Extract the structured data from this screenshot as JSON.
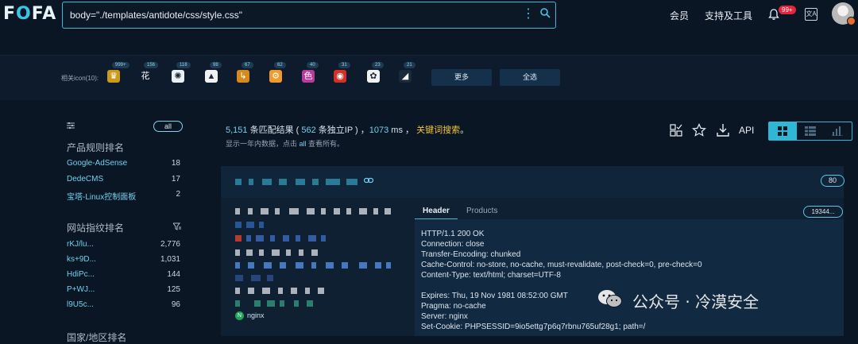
{
  "app": {
    "logo": "FOFA"
  },
  "search": {
    "value": "body=\"./templates/antidote/css/style.css\""
  },
  "nav": {
    "member": "会员",
    "support": "支持及工具",
    "badge": "99+",
    "translate": "文A"
  },
  "icons": {
    "label": "相关icon(10):",
    "items": [
      {
        "count": "999+",
        "color": "#c99a1b",
        "glyph": "♛"
      },
      {
        "count": "156",
        "color": "#0d1b2c",
        "glyph": "花"
      },
      {
        "count": "118",
        "color": "#e9f1f7",
        "glyph": "✺"
      },
      {
        "count": "98",
        "color": "#f2f2f2",
        "glyph": "▲"
      },
      {
        "count": "67",
        "color": "#d48a1c",
        "glyph": "↳"
      },
      {
        "count": "62",
        "color": "#f19a2c",
        "glyph": "⚙"
      },
      {
        "count": "40",
        "color": "#b93c9b",
        "glyph": "色"
      },
      {
        "count": "31",
        "color": "#d3302a",
        "glyph": "◉"
      },
      {
        "count": "23",
        "color": "#f2f2f2",
        "glyph": "✿"
      },
      {
        "count": "21",
        "color": "#1a2a3a",
        "glyph": "◢"
      }
    ],
    "more": "更多",
    "select_all": "全选"
  },
  "sidebar": {
    "all": "all",
    "rule_title": "产品规则排名",
    "rules": [
      {
        "name": "Google-AdSense",
        "count": "18"
      },
      {
        "name": "DedeCMS",
        "count": "17"
      },
      {
        "name": "宝塔-Linux控制面板",
        "count": "2"
      }
    ],
    "finger_title": "网站指纹排名",
    "fingers": [
      {
        "name": "rKJ/lu...",
        "count": "2,776"
      },
      {
        "name": "ks+9D...",
        "count": "1,031"
      },
      {
        "name": "HdiPc...",
        "count": "144"
      },
      {
        "name": "P+WJ...",
        "count": "125"
      },
      {
        "name": "l9U5c...",
        "count": "96"
      }
    ],
    "region_title": "国家/地区排名"
  },
  "summary": {
    "count": "5,151",
    "t1": " 条匹配结果 ( ",
    "ip": "562",
    "t2": " 条独立IP ) ，",
    "ms": "1073",
    "t3": " ms ， ",
    "keyword": "关键词搜索",
    "t4": "。",
    "sub1": "显示一年内数据，点击 ",
    "sub_all": "all",
    "sub2": " 查看所有。"
  },
  "toolbar": {
    "api": "API"
  },
  "result": {
    "badge": "80",
    "tab_header": "Header",
    "tab_products": "Products",
    "pill": "19344...",
    "header_lines": [
      "HTTP/1.1 200 OK",
      "Connection: close",
      "Transfer-Encoding: chunked",
      "Cache-Control: no-store, no-cache, must-revalidate, post-check=0, pre-check=0",
      "Content-Type: text/html; charset=UTF-8",
      "",
      "Expires: Thu, 19 Nov 1981 08:52:00 GMT",
      "Pragma: no-cache",
      "Server: nginx",
      "Set-Cookie: PHPSESSID=9io5ettg7p6q7rbnu765uf28g1; path=/"
    ],
    "server_tag": "nginx"
  },
  "watermark": {
    "text": "公众号 · 冷漠安全"
  }
}
